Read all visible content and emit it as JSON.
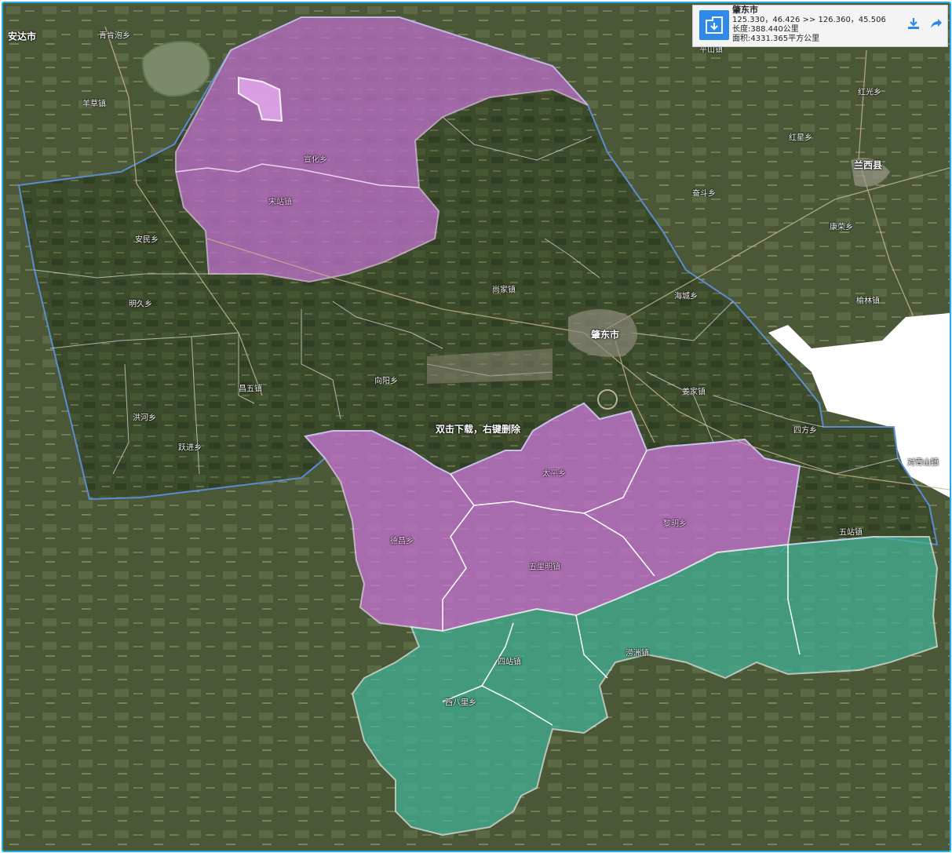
{
  "info_panel": {
    "name": "肇东市",
    "coords": "125.330，46.426 >> 126.360，45.506",
    "length": "长度:388.440公里",
    "area": "面积:4331.365平方公里",
    "download_icon": "download-icon",
    "share_icon": "share-icon"
  },
  "hint": "双击下载，右键删除",
  "colors": {
    "boundary": "#5b8fd8",
    "selected_fill": "#c873d6",
    "green_fill": "#3fb59a",
    "frame": "#26a9e6"
  },
  "labels": {
    "l0": "安达市",
    "l1": "青肯泡乡",
    "l2": "羊草镇",
    "l3": "宣化乡",
    "l4": "宋站镇",
    "l5": "安民乡",
    "l6": "明久乡",
    "l7": "尚家镇",
    "l8": "海城乡",
    "l9": "肇东市",
    "l10": "向阳乡",
    "l11": "昌五镇",
    "l12": "洪河乡",
    "l13": "跃进乡",
    "l14": "姜家镇",
    "l15": "四方乡",
    "l16": "对青山镇",
    "l17": "太平乡",
    "l18": "德昌乡",
    "l19": "五里明镇",
    "l20": "黎明乡",
    "l21": "五站镇",
    "l22": "四站镇",
    "l23": "西八里乡",
    "l24": "涝洲镇",
    "l25": "红光乡",
    "l26": "红星乡",
    "l27": "兰西县",
    "l28": "奋斗乡",
    "l29": "康荣乡",
    "l30": "榆林镇",
    "l31": "平山镇"
  }
}
